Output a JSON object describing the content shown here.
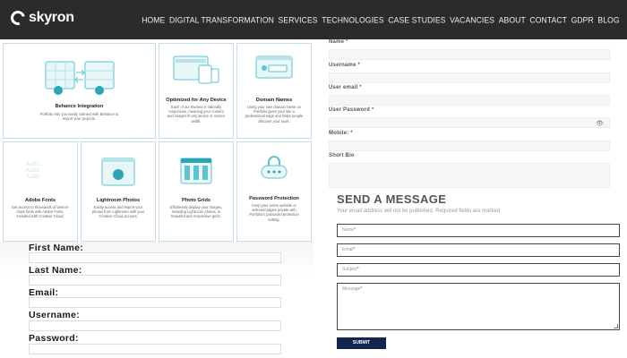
{
  "header": {
    "logo": "skyron",
    "nav": [
      "HOME",
      "DIGITAL TRANSFORMATION",
      "SERVICES",
      "TECHNOLOGIES",
      "CASE STUDIES",
      "VACANCIES",
      "ABOUT",
      "CONTACT",
      "GDPR",
      "BLOG"
    ]
  },
  "features": [
    {
      "title": "Behance Integration",
      "desc": "Portfolio lets you easily connect with Behance to import your projects.",
      "icon": "behance-sync-icon"
    },
    {
      "title": "Optimized for Any Device",
      "desc": "Each of our themes is naturally responsive, meaning your content and images fit any device or screen width.",
      "icon": "devices-icon"
    },
    {
      "title": "Domain Names",
      "desc": "Using your own domain name on Portfolio gives your site a professional edge and helps people discover your work.",
      "icon": "domain-icon"
    },
    {
      "title": "Adobe Fonts",
      "desc": "Get access to thousands of best-in-class fonts with Adobe Fonts, included with Creative Cloud.",
      "icon": "fonts-icon"
    },
    {
      "title": "Lightroom Photos",
      "desc": "Easily access and import your photos from Lightroom with your Creative Cloud account.",
      "icon": "lightroom-icon"
    },
    {
      "title": "Photo Grids",
      "desc": "Effortlessly display your images, including Lightroom photos, in beautiful and responsive grids.",
      "icon": "photo-grid-icon"
    },
    {
      "title": "Password Protection",
      "desc": "Keep your entire website or selected pages private with Portfolio's password protection setting.",
      "icon": "lock-icon"
    }
  ],
  "left_form": {
    "labels": [
      "First Name:",
      "Last Name:",
      "Email:",
      "Username:",
      "Password:"
    ]
  },
  "register_form": {
    "fields": [
      {
        "label": "Name",
        "required": "*"
      },
      {
        "label": "Username",
        "required": "*"
      },
      {
        "label": "User email",
        "required": "*"
      },
      {
        "label": "User Password",
        "required": "*"
      },
      {
        "label": "Mobile:",
        "required": "*"
      },
      {
        "label": "Short Bio",
        "required": ""
      }
    ],
    "eye_icon": "👁"
  },
  "message": {
    "title": "SEND A MESSAGE",
    "note": "Your email address will not be published. Required fields are marked",
    "fields": [
      {
        "placeholder": "Name",
        "required": "*"
      },
      {
        "placeholder": "Email",
        "required": "*"
      },
      {
        "placeholder": "Subject",
        "required": "*"
      },
      {
        "placeholder": "Message",
        "required": "*"
      }
    ],
    "submit": "SUBMIT"
  }
}
